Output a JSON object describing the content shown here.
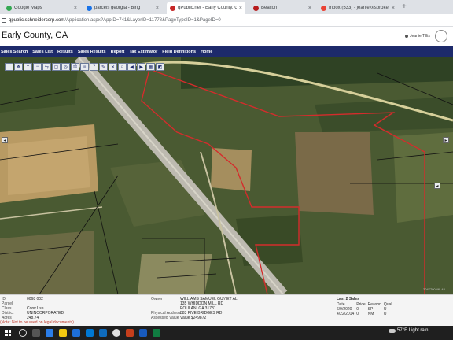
{
  "browser": {
    "tabs": [
      {
        "label": "Google Maps",
        "color": "#34a853"
      },
      {
        "label": "parcels georgia - Bing",
        "color": "#1a73e8"
      },
      {
        "label": "qPublic.net - Early County, GA -",
        "color": "#c62828"
      },
      {
        "label": "Beacon",
        "color": "#b71c1c"
      },
      {
        "label": "Inbox (533) - jeanie@sbroker0...",
        "color": "#ea4335"
      }
    ],
    "new_tab": "+",
    "url_domain": "qpublic.schneidercorp.com",
    "url_path": "/Application.aspx?AppID=741&LayerID=11778&PageTypeID=1&PageID=0"
  },
  "header": {
    "title": "Early County, GA",
    "user": "Jeanie Tillis"
  },
  "nav": {
    "items": [
      "Sales Search",
      "Sales List",
      "Results",
      "Sales Results",
      "Report",
      "Tax Estimator",
      "Field Definitions",
      "Home"
    ]
  },
  "map": {
    "coords": "2047700.46, 44…",
    "tool_icons": [
      "info-icon",
      "pan-icon",
      "zoom-in-icon",
      "zoom-out-icon",
      "measure-icon",
      "select-icon",
      "buffer-icon",
      "print-icon",
      "layers-icon",
      "identify-icon",
      "draw-icon",
      "clear-icon",
      "home-icon",
      "back-icon",
      "forward-icon",
      "map-icon",
      "aerial-icon"
    ]
  },
  "parcel": {
    "labels": {
      "id": "ID",
      "parcel": "Parcel",
      "class": "Class",
      "district": "District",
      "acres": "Acres"
    },
    "values": {
      "id": "0068 002",
      "parcel": "",
      "class": "Conv.Use",
      "district": "UNINCORPORATED",
      "acres": "248.74"
    },
    "owner_label": "Owner",
    "owner": [
      "WILLIAMS SAMUEL GUY ET AL",
      "135 WHIDDON MILL RD",
      "POULAN, GA 31781"
    ],
    "address_label": "Physical Address",
    "address": "583 FIVE BRIDGES RD",
    "assessed_label": "Assessed Value",
    "assessed": "Value $249872",
    "note": "(Note: Not to be used on legal documents)"
  },
  "sales": {
    "heading": "Last 2 Sales",
    "columns": [
      "Date",
      "Price",
      "Reason",
      "Qual"
    ],
    "rows": [
      [
        "6/9/2020",
        "0",
        "SP",
        "U"
      ],
      [
        "4/22/2014",
        "0",
        "NM",
        "U"
      ]
    ]
  },
  "taskbar": {
    "temperature": "57°F",
    "weather": "Light rain"
  }
}
